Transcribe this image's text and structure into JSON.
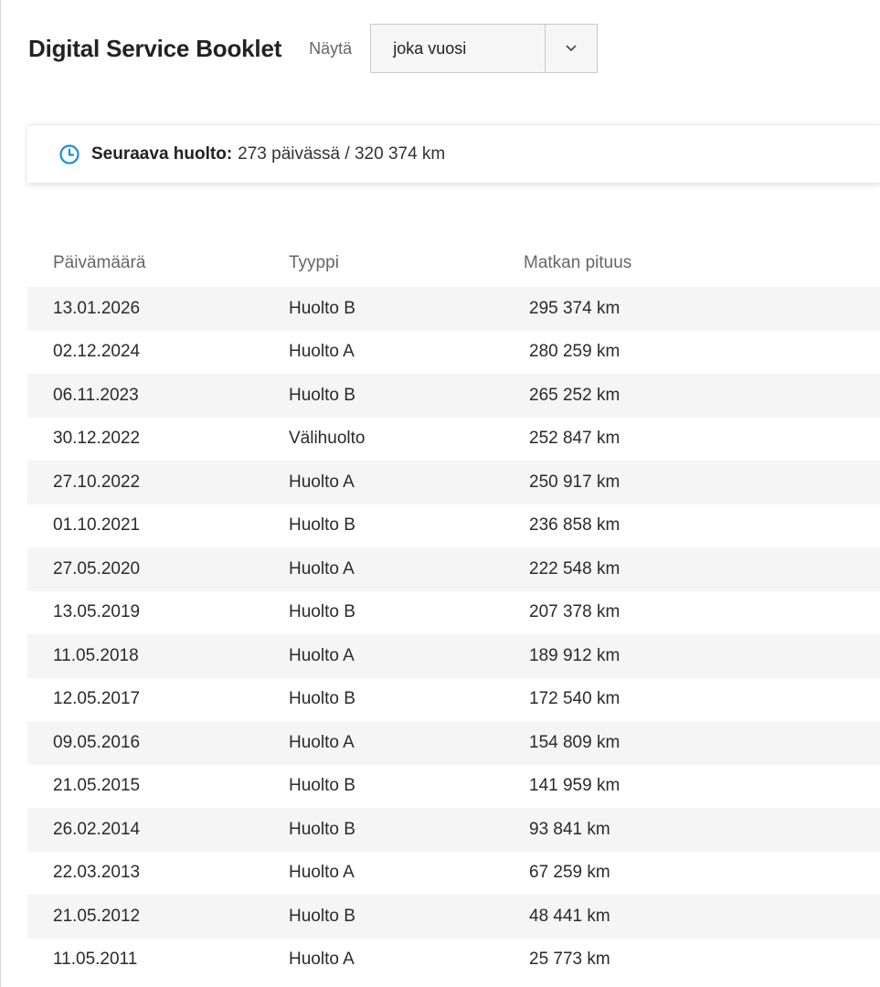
{
  "header": {
    "title": "Digital Service Booklet",
    "show_label": "Näytä",
    "filter": {
      "selected": "joka vuosi",
      "toggle_icon": "chevron-down-icon"
    }
  },
  "next_service": {
    "icon": "clock-icon",
    "label": "Seuraava huolto:",
    "value": "273 päivässä / 320 374 km"
  },
  "table": {
    "columns": [
      "Päivämäärä",
      "Tyyppi",
      "Matkan pituus"
    ],
    "rows": [
      {
        "date": "13.01.2026",
        "type": "Huolto B",
        "distance": "295 374 km"
      },
      {
        "date": "02.12.2024",
        "type": "Huolto A",
        "distance": "280 259 km"
      },
      {
        "date": "06.11.2023",
        "type": "Huolto B",
        "distance": "265 252 km"
      },
      {
        "date": "30.12.2022",
        "type": "Välihuolto",
        "distance": "252 847 km"
      },
      {
        "date": "27.10.2022",
        "type": "Huolto A",
        "distance": "250 917 km"
      },
      {
        "date": "01.10.2021",
        "type": "Huolto B",
        "distance": "236 858 km"
      },
      {
        "date": "27.05.2020",
        "type": "Huolto A",
        "distance": "222 548 km"
      },
      {
        "date": "13.05.2019",
        "type": "Huolto B",
        "distance": "207 378 km"
      },
      {
        "date": "11.05.2018",
        "type": "Huolto A",
        "distance": "189 912 km"
      },
      {
        "date": "12.05.2017",
        "type": "Huolto B",
        "distance": "172 540 km"
      },
      {
        "date": "09.05.2016",
        "type": "Huolto A",
        "distance": "154 809 km"
      },
      {
        "date": "21.05.2015",
        "type": "Huolto B",
        "distance": "141 959 km"
      },
      {
        "date": "26.02.2014",
        "type": "Huolto B",
        "distance": "93 841 km"
      },
      {
        "date": "22.03.2013",
        "type": "Huolto A",
        "distance": "67 259 km"
      },
      {
        "date": "21.05.2012",
        "type": "Huolto B",
        "distance": "48 441 km"
      },
      {
        "date": "11.05.2011",
        "type": "Huolto A",
        "distance": "25 773 km"
      }
    ]
  },
  "colors": {
    "accent": "#1a8fd3",
    "row_shade": "#f5f5f5",
    "muted_text": "#666666"
  }
}
